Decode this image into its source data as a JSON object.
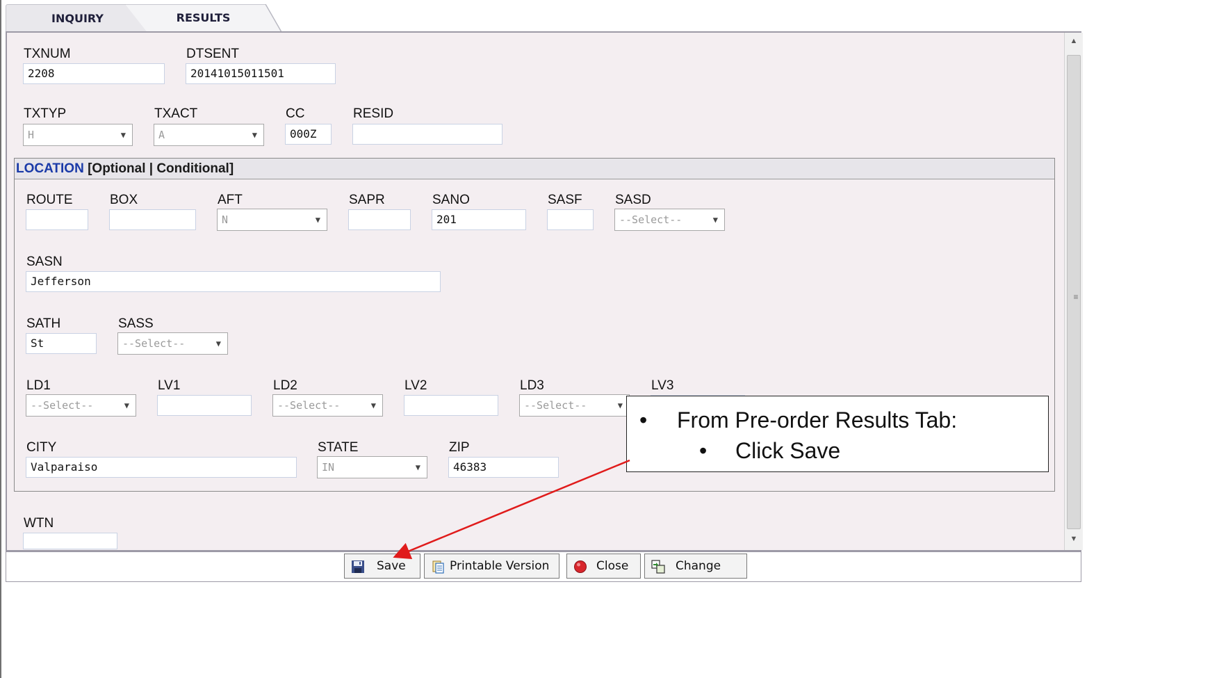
{
  "tabs": {
    "inquiry": "INQUIRY",
    "results": "RESULTS"
  },
  "fields": {
    "txnum": {
      "label": "TXNUM",
      "value": "2208"
    },
    "dtsent": {
      "label": "DTSENT",
      "value": "20141015011501"
    },
    "txtyp": {
      "label": "TXTYP",
      "value": "H"
    },
    "txact": {
      "label": "TXACT",
      "value": "A"
    },
    "cc": {
      "label": "CC",
      "value": "000Z"
    },
    "resid": {
      "label": "RESID",
      "value": ""
    }
  },
  "location": {
    "title": "LOCATION",
    "subtitle": " [Optional | Conditional]",
    "route": {
      "label": "ROUTE",
      "value": ""
    },
    "box": {
      "label": "BOX",
      "value": ""
    },
    "aft": {
      "label": "AFT",
      "value": "N"
    },
    "sapr": {
      "label": "SAPR",
      "value": ""
    },
    "sano": {
      "label": "SANO",
      "value": "201"
    },
    "sasf": {
      "label": "SASF",
      "value": ""
    },
    "sasd": {
      "label": "SASD",
      "value": "--Select--"
    },
    "sasn": {
      "label": "SASN",
      "value": "Jefferson"
    },
    "sath": {
      "label": "SATH",
      "value": "St"
    },
    "sass": {
      "label": "SASS",
      "value": "--Select--"
    },
    "ld1": {
      "label": "LD1",
      "value": "--Select--"
    },
    "lv1": {
      "label": "LV1",
      "value": ""
    },
    "ld2": {
      "label": "LD2",
      "value": "--Select--"
    },
    "lv2": {
      "label": "LV2",
      "value": ""
    },
    "ld3": {
      "label": "LD3",
      "value": "--Select--"
    },
    "lv3": {
      "label": "LV3",
      "value": ""
    },
    "city": {
      "label": "CITY",
      "value": "Valparaiso"
    },
    "state": {
      "label": "STATE",
      "value": "IN"
    },
    "zip": {
      "label": "ZIP",
      "value": "46383"
    }
  },
  "wtn": {
    "label": "WTN",
    "value": ""
  },
  "buttons": {
    "save": "Save",
    "printable": "Printable Version",
    "close": "Close",
    "change": "Change"
  },
  "callout": {
    "bullet": "•",
    "line1": "From Pre-order Results Tab:",
    "line2": "Click Save"
  },
  "icons": [
    "save-icon",
    "printable-icon",
    "close-icon",
    "change-icon",
    "dropdown-arrow-icon"
  ],
  "colors": {
    "panel_bg": "#f4eef1",
    "section_title": "#1a3aa8",
    "annotation_arrow": "#e01b1b"
  }
}
